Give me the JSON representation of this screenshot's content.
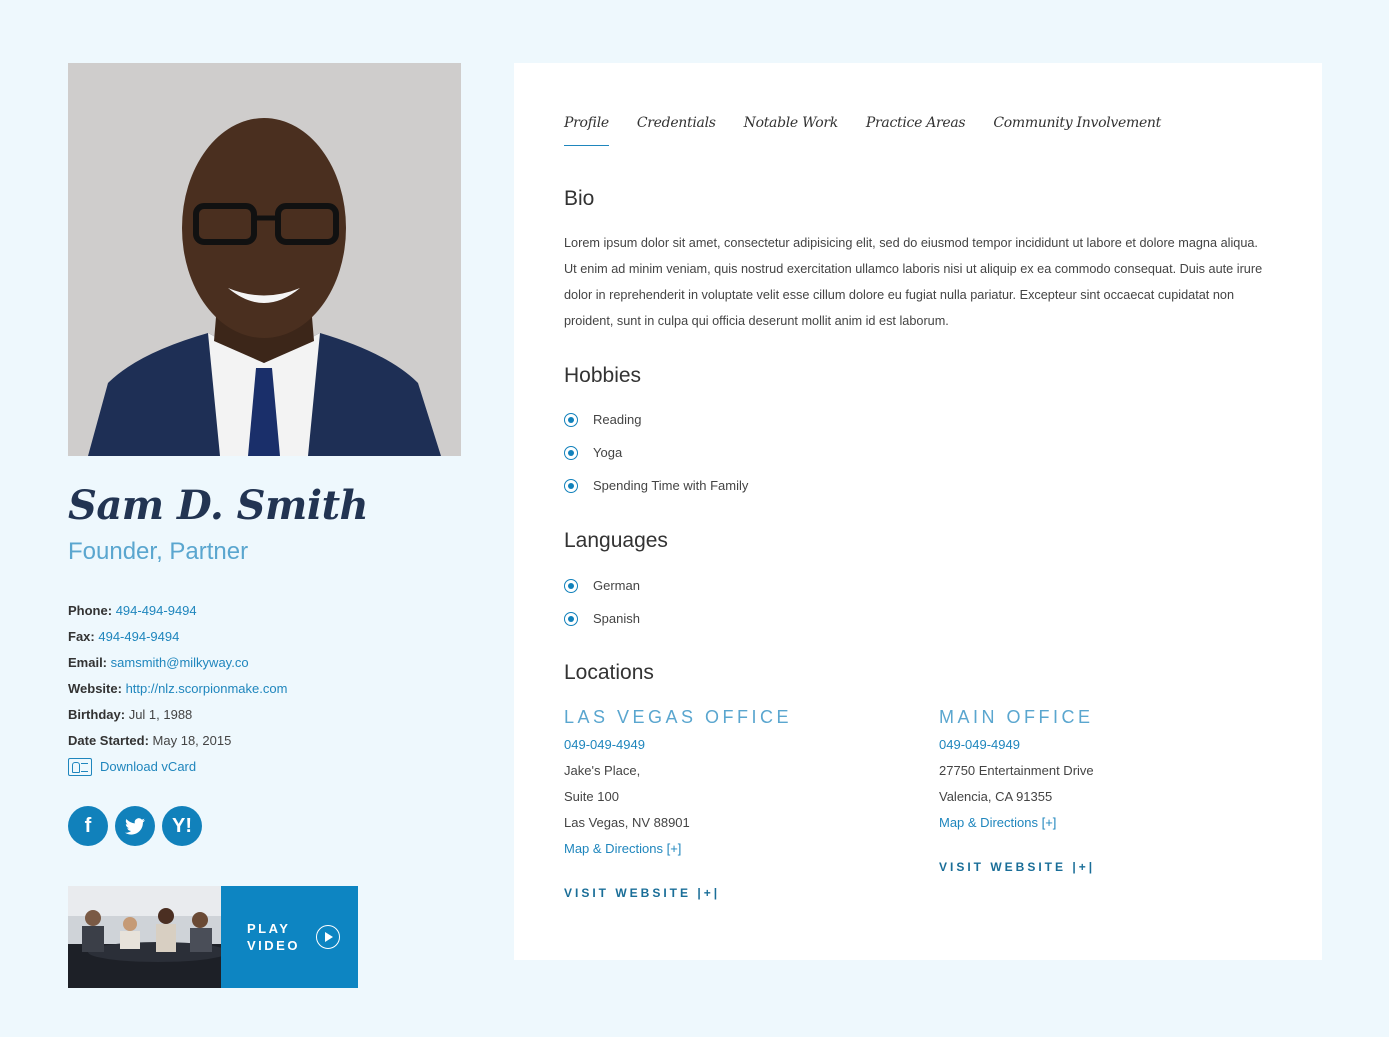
{
  "profile": {
    "name": "Sam D. Smith",
    "title": "Founder, Partner"
  },
  "contact": {
    "phone_label": "Phone:",
    "phone": "494-494-9494",
    "fax_label": "Fax:",
    "fax": "494-494-9494",
    "email_label": "Email:",
    "email": "samsmith@milkyway.co",
    "website_label": "Website:",
    "website": "http://nlz.scorpionmake.com",
    "birthday_label": "Birthday:",
    "birthday": "Jul 1, 1988",
    "started_label": "Date Started:",
    "started": "May 18, 2015",
    "vcard": "Download vCard"
  },
  "socials": {
    "facebook": "f",
    "yahoo": "Y!"
  },
  "video": {
    "line1": "PLAY",
    "line2": "VIDEO"
  },
  "tabs": [
    "Profile",
    "Credentials",
    "Notable Work",
    "Practice Areas",
    "Community Involvement"
  ],
  "bio": {
    "heading": "Bio",
    "text": "Lorem ipsum dolor sit amet, consectetur adipisicing elit, sed do eiusmod tempor incididunt ut labore et dolore magna aliqua. Ut enim ad minim veniam, quis nostrud exercitation ullamco laboris nisi ut aliquip ex ea commodo consequat. Duis aute irure dolor in reprehenderit in voluptate velit esse cillum dolore eu fugiat nulla pariatur. Excepteur sint occaecat cupidatat non proident, sunt in culpa qui officia deserunt mollit anim id est laborum."
  },
  "hobbies": {
    "heading": "Hobbies",
    "items": [
      "Reading",
      "Yoga",
      "Spending Time with Family"
    ]
  },
  "languages": {
    "heading": "Languages",
    "items": [
      "German",
      "Spanish"
    ]
  },
  "locations": {
    "heading": "Locations",
    "offices": [
      {
        "name": "LAS VEGAS OFFICE",
        "phone": "049-049-4949",
        "lines": [
          "Jake's Place,",
          "Suite 100",
          "Las Vegas, NV 88901"
        ],
        "map": "Map & Directions [+]",
        "visit": "VISIT WEBSITE |+|"
      },
      {
        "name": "MAIN OFFICE",
        "phone": "049-049-4949",
        "lines": [
          "27750 Entertainment Drive",
          "Valencia, CA 91355"
        ],
        "map": "Map & Directions [+]",
        "visit": "VISIT WEBSITE |+|"
      }
    ]
  },
  "colors": {
    "background": "#eef8fd",
    "accent": "#1181bb",
    "name": "#223452",
    "subtitle": "#5aa6cf"
  }
}
